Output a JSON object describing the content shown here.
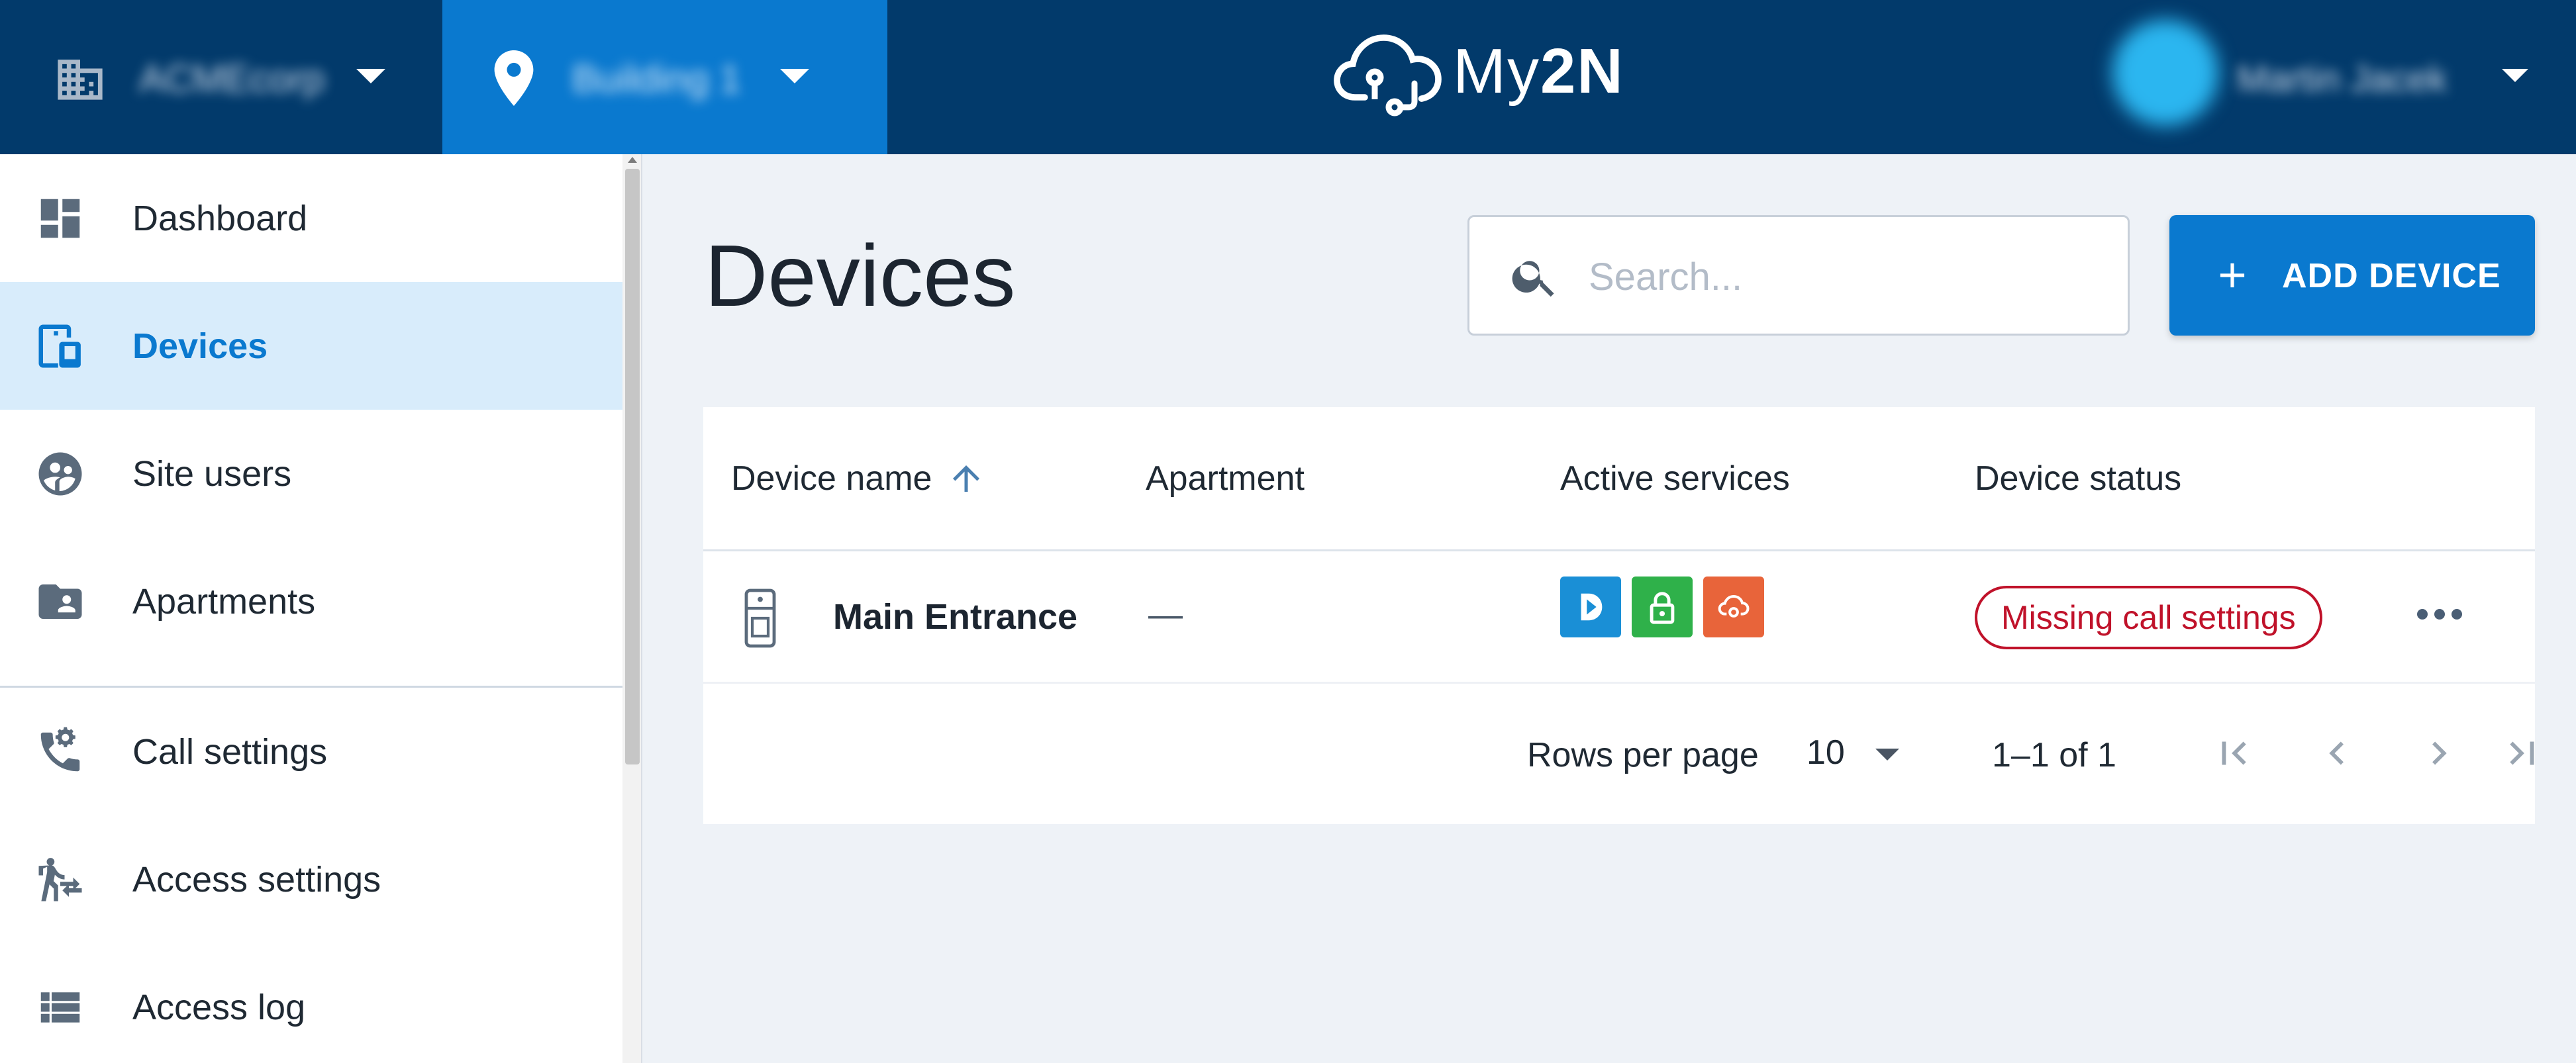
{
  "header": {
    "company_name": "ACMEcorp",
    "site_name": "Building 1",
    "logo_text_light": "My",
    "logo_text_bold": "2N",
    "user_name": "Martin Jacek"
  },
  "sidebar": {
    "items": [
      {
        "label": "Dashboard",
        "icon": "dashboard-icon"
      },
      {
        "label": "Devices",
        "icon": "devices-icon",
        "active": true
      },
      {
        "label": "Site users",
        "icon": "site-users-icon"
      },
      {
        "label": "Apartments",
        "icon": "apartments-icon"
      },
      {
        "label": "Call settings",
        "icon": "call-settings-icon"
      },
      {
        "label": "Access settings",
        "icon": "access-settings-icon"
      },
      {
        "label": "Access log",
        "icon": "access-log-icon"
      }
    ]
  },
  "main": {
    "title": "Devices",
    "search_placeholder": "Search...",
    "add_button_label": "ADD DEVICE",
    "table": {
      "columns": [
        "Device name",
        "Apartment",
        "Active services",
        "Device status"
      ],
      "rows": [
        {
          "device_name": "Main Entrance",
          "apartment": "—",
          "services": [
            "my2n-app-icon",
            "lock-icon",
            "cloud-settings-icon"
          ],
          "status": "Missing call settings"
        }
      ]
    },
    "pagination": {
      "rows_per_page_label": "Rows per page",
      "rows_per_page_value": "10",
      "range_text": "1–1 of 1"
    }
  },
  "colors": {
    "topbar": "#023a6b",
    "accent": "#0a79cf",
    "active_bg": "#d8ecfb",
    "status_error": "#c0122a",
    "service_blue": "#1a8fd6",
    "service_green": "#2fb14a",
    "service_orange": "#e8643a"
  }
}
